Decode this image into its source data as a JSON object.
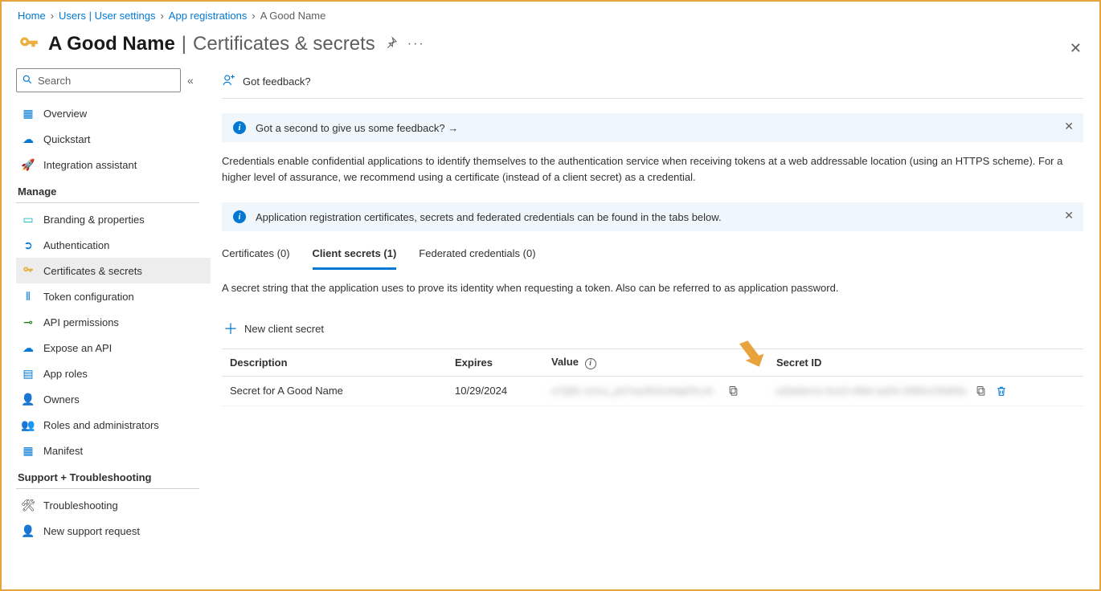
{
  "breadcrumb": {
    "items": [
      {
        "label": "Home"
      },
      {
        "label": "Users | User settings"
      },
      {
        "label": "App registrations"
      }
    ],
    "current": "A Good Name"
  },
  "header": {
    "title": "A Good Name",
    "subtitle": "Certificates & secrets"
  },
  "search": {
    "placeholder": "Search"
  },
  "sidebar": {
    "top": [
      {
        "icon": "grid",
        "label": "Overview"
      },
      {
        "icon": "cloud",
        "label": "Quickstart"
      },
      {
        "icon": "rocket",
        "label": "Integration assistant"
      }
    ],
    "manage_title": "Manage",
    "manage": [
      {
        "icon": "brand",
        "label": "Branding & properties"
      },
      {
        "icon": "auth",
        "label": "Authentication"
      },
      {
        "icon": "key",
        "label": "Certificates & secrets",
        "active": true
      },
      {
        "icon": "token",
        "label": "Token configuration"
      },
      {
        "icon": "api-perm",
        "label": "API permissions"
      },
      {
        "icon": "expose",
        "label": "Expose an API"
      },
      {
        "icon": "roles",
        "label": "App roles"
      },
      {
        "icon": "owners",
        "label": "Owners"
      },
      {
        "icon": "admins",
        "label": "Roles and administrators"
      },
      {
        "icon": "manifest",
        "label": "Manifest"
      }
    ],
    "support_title": "Support + Troubleshooting",
    "support": [
      {
        "icon": "wrench",
        "label": "Troubleshooting"
      },
      {
        "icon": "newreq",
        "label": "New support request"
      }
    ]
  },
  "toolbar": {
    "feedback": "Got feedback?"
  },
  "banners": {
    "b1": "Got a second to give us some feedback?  →",
    "b2": "Application registration certificates, secrets and federated credentials can be found in the tabs below."
  },
  "description": "Credentials enable confidential applications to identify themselves to the authentication service when receiving tokens at a web addressable location (using an HTTPS scheme). For a higher level of assurance, we recommend using a certificate (instead of a client secret) as a credential.",
  "tabs": {
    "t1": "Certificates (0)",
    "t2": "Client secrets (1)",
    "t3": "Federated credentials (0)"
  },
  "tab_description": "A secret string that the application uses to prove its identity when requesting a token. Also can be referred to as application password.",
  "new_secret_label": "New client secret",
  "table": {
    "headers": {
      "desc": "Description",
      "expires": "Expires",
      "value": "Value",
      "secretid": "Secret ID"
    },
    "row": {
      "desc": "Secret for A Good Name",
      "expires": "10/29/2024",
      "value_masked": "x7Q8s   oUvu_pXYwuRZmAdpFtLvh .",
      "id_masked": "a2bd4e1e-0ce3-4fb6-aa54-2f90e130df3e"
    }
  }
}
